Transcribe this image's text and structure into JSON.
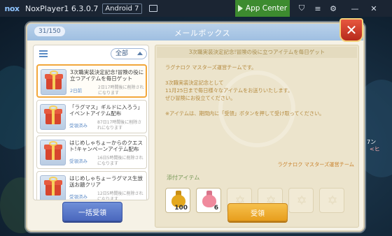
{
  "titlebar": {
    "logo": "nox",
    "title": "NoxPlayer1 6.3.0.7",
    "android": "Android 7",
    "app_center": "App Center",
    "icons": [
      "screen-icon",
      "shirt-icon",
      "menu-icon",
      "settings-icon",
      "minimize-icon",
      "close-icon"
    ]
  },
  "mailbox": {
    "counter": "31/150",
    "title": "メールボックス",
    "close_label": "✕",
    "filter": "全部",
    "items": [
      {
        "title": "3次職実装決定記念!冒険の役に立つアイテムを毎日ゲット",
        "status": "2日前",
        "expire": "2日17時間後に削除されになります"
      },
      {
        "title": "「ラグマス」ギルドに入ろう」イベントアイテム配布",
        "status": "受領済み",
        "expire": "87日17時間後に削除されになります"
      },
      {
        "title": "はじめしゃちょーからのクエスト!キャンペーンアイテム配布",
        "status": "受領済み",
        "expire": "16日5時間後に削除されになります"
      },
      {
        "title": "はじめしゃちょーラグマス生放送お題クリア",
        "status": "受領済み",
        "expire": "12日5時間後に削除されになります"
      }
    ],
    "bulk_receive": "一括受領",
    "detail": {
      "title": "3次職実装決定記念!冒険の役に立つアイテムを毎日ゲット",
      "lines": [
        "ラグナロク マスターズ運営チームです。",
        "",
        "3次職実装決定記念として",
        "11月25日まで毎日様々なアイテムをお送りいたします。",
        "ぜひ冒険にお役立てください。",
        "",
        "※アイテムは、期間内に「受領」ボタンを押して受け取ってください。"
      ],
      "signature": "ラグナロク マスターズ運営チーム",
      "attachments_label": "添付アイテム",
      "attachments": [
        {
          "name": "yellow-potion-icon",
          "qty": "100",
          "color": "#e4a81e"
        },
        {
          "name": "pink-potion-icon",
          "qty": "6",
          "color": "#f08a9d"
        }
      ],
      "empty_slots": 5
    },
    "receive": "受領"
  },
  "side": {
    "label": "7ン",
    "label2": "<ヒ"
  }
}
